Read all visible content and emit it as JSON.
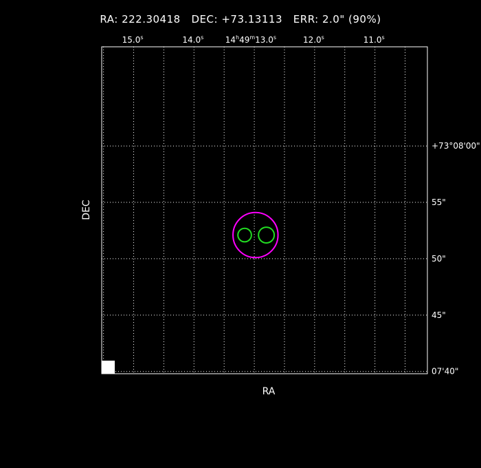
{
  "header": {
    "ra_label": "RA:",
    "ra_value": "222.30418",
    "dec_label": "DEC:",
    "dec_value": "+73.13113",
    "err_label": "ERR:",
    "err_value": "2.0\" (90%)"
  },
  "chart_data": {
    "type": "scatter",
    "title": "RA: 222.30418   DEC: +73.13113   ERR: 2.0\" (90%)",
    "xlabel": "RA",
    "ylabel": "DEC",
    "grid": true,
    "x_unit": "RA seconds of time (14h49m)",
    "y_unit": "DEC arcseconds offset from +73°07'",
    "xlim": [
      15.53,
      10.13
    ],
    "ylim": [
      39.8,
      68.8
    ],
    "x_ticks": [
      {
        "v": 15.0,
        "label": "15.0",
        "sup": "s"
      },
      {
        "v": 14.0,
        "label": "14.0",
        "sup": "s"
      },
      {
        "v": 13.0,
        "label": "13.0",
        "sup": "s",
        "prefix": "14",
        "prefix_sup": "h",
        "mid": "49",
        "mid_sup": "m"
      },
      {
        "v": 12.0,
        "label": "12.0",
        "sup": "s"
      },
      {
        "v": 11.0,
        "label": "11.0",
        "sup": "s"
      }
    ],
    "x_minor": [
      15.5,
      15.0,
      14.5,
      14.0,
      13.5,
      13.0,
      12.5,
      12.0,
      11.5,
      11.0,
      10.5
    ],
    "y_ticks": [
      {
        "v": 60.0,
        "label": "+73°08'00\""
      },
      {
        "v": 55.0,
        "label": "55\""
      },
      {
        "v": 50.0,
        "label": "50\""
      },
      {
        "v": 45.0,
        "label": "45\""
      },
      {
        "v": 40.0,
        "label": "07'40\""
      }
    ],
    "error_circle": {
      "x": 12.98,
      "y": 52.1,
      "radius_arcsec": 2.0,
      "color": "#ff00ff"
    },
    "sources": [
      {
        "x": 13.16,
        "y": 52.1,
        "radius_arcsec": 0.6,
        "color": "#22dd22"
      },
      {
        "x": 12.8,
        "y": 52.1,
        "radius_arcsec": 0.7,
        "color": "#22dd22"
      }
    ]
  }
}
